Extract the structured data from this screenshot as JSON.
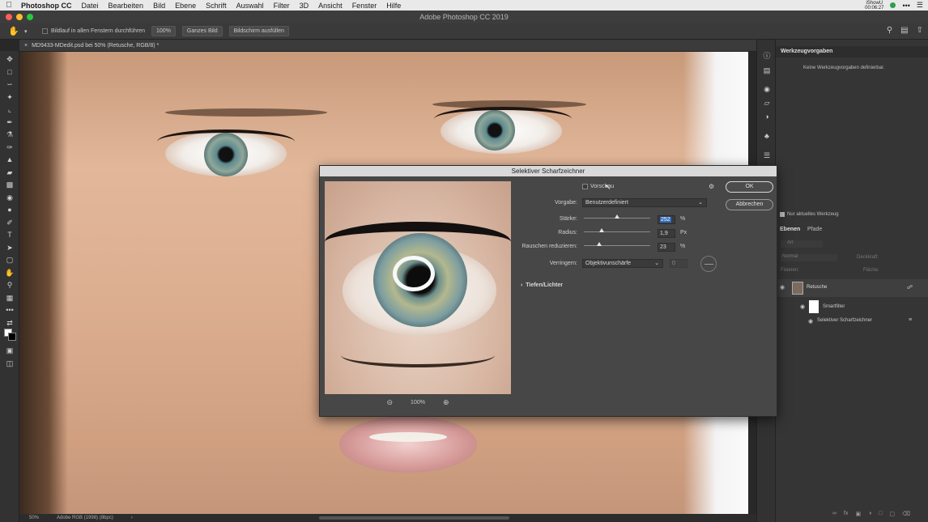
{
  "menubar": {
    "app_name": "Photoshop CC",
    "items": [
      "Datei",
      "Bearbeiten",
      "Bild",
      "Ebene",
      "Schrift",
      "Auswahl",
      "Filter",
      "3D",
      "Ansicht",
      "Fenster",
      "Hilfe"
    ],
    "clock_line1": "iShowU",
    "clock_line2": "00:06:27"
  },
  "window": {
    "title": "Adobe Photoshop CC 2019"
  },
  "options_bar": {
    "scroll_all_label": "Bildlauf in allen Fenstern durchführen",
    "zoom_100": "100%",
    "fit_screen": "Ganzes Bild",
    "fill_screen": "Bildschirm ausfüllen"
  },
  "document": {
    "tab_title": "MD9433-MDedit.psd bei 50% (Retusche, RGB/8) *"
  },
  "status_bar": {
    "zoom": "50%",
    "profile": "Adobe RGB (1998) (8bpc)"
  },
  "panels": {
    "tool_presets": {
      "title": "Werkzeugvorgaben",
      "empty_text": "Keine Werkzeugvorgaben definierbar.",
      "current_tool_only": "Nur aktuelles Werkzeug"
    },
    "layers": {
      "tab_layers": "Ebenen",
      "tab_paths": "Pfade",
      "kind_filter": "Art",
      "blend_mode": "Normal",
      "opacity_label": "Deckkraft:",
      "lock_label": "Fixieren:",
      "fill_label": "Fläche:",
      "items": [
        {
          "name": "Retusche"
        },
        {
          "name": "Smartfilter"
        },
        {
          "name": "Selektiver Scharfzeichner"
        }
      ]
    }
  },
  "dialog": {
    "title": "Selektiver Scharfzeichner",
    "preview_label": "Vorschau",
    "ok": "OK",
    "cancel": "Abbrechen",
    "preset_label": "Vorgabe:",
    "preset_value": "Benutzerdefiniert",
    "amount_label": "Stärke:",
    "amount_value": "252",
    "amount_unit": "%",
    "amount_fraction": 0.5,
    "radius_label": "Radius:",
    "radius_value": "1,9",
    "radius_unit": "Px",
    "radius_fraction": 0.27,
    "noise_label": "Rauschen reduzieren:",
    "noise_value": "23",
    "noise_unit": "%",
    "noise_fraction": 0.23,
    "remove_label": "Verringern:",
    "remove_value": "Objektivunschärfe",
    "angle_value": "0",
    "shadows_highlights": "Tiefen/Lichter",
    "preview_zoom": "100%"
  },
  "colors": {
    "ui_dark": "#282828",
    "panel": "#353535",
    "dialog": "#474747",
    "selection": "#2f6fbf",
    "traffic_red": "#fe5f57",
    "traffic_yellow": "#febc2e",
    "traffic_green": "#28c840"
  }
}
